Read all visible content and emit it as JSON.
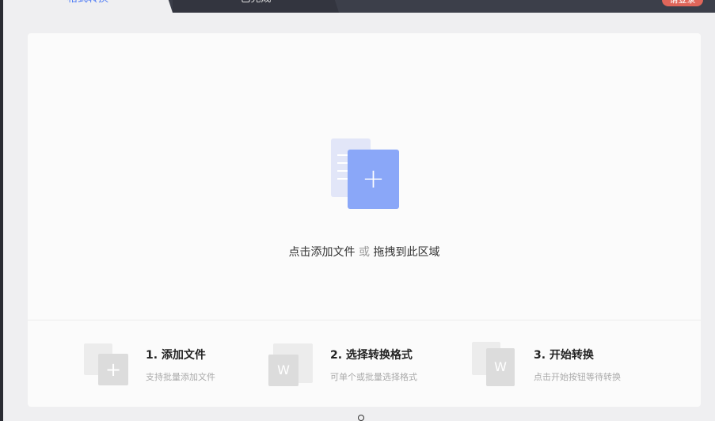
{
  "tabs": [
    {
      "label": "格式转换",
      "active": true
    },
    {
      "label": "已完成",
      "active": false
    }
  ],
  "login_label": "请登录",
  "dropzone": {
    "hint_add": "点击添加文件",
    "hint_or": "或",
    "hint_drag": "拖拽到此区域"
  },
  "steps": [
    {
      "title": "1. 添加文件",
      "desc": "支持批量添加文件"
    },
    {
      "title": "2. 选择转换格式",
      "desc": "可单个或批量选择格式"
    },
    {
      "title": "3. 开始转换",
      "desc": "点击开始按钮等待转换"
    }
  ],
  "colors": {
    "accent": "#4a78f5",
    "upload_icon": "#8aa7f8",
    "login": "#e0665a"
  }
}
